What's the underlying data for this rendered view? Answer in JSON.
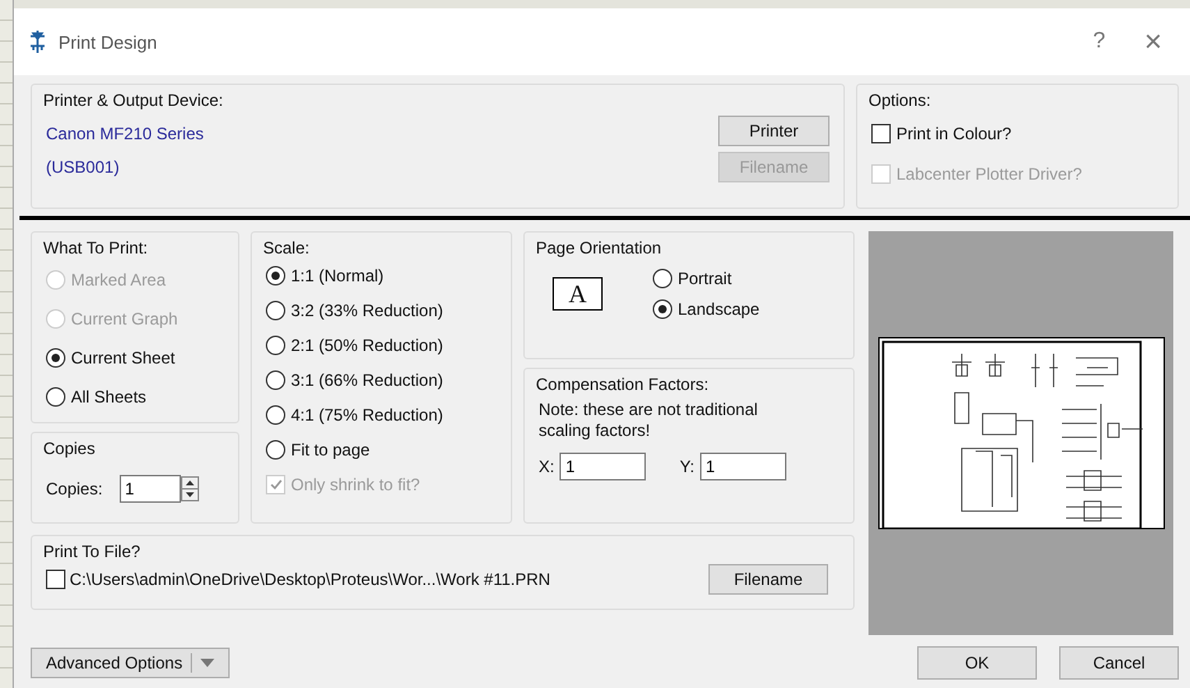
{
  "window": {
    "title": "Print Design",
    "help": "?",
    "close": "×"
  },
  "printer": {
    "title": "Printer & Output Device:",
    "name": "Canon MF210 Series",
    "port": "(USB001)",
    "buttons": [
      {
        "label": "Printer",
        "disabled": false
      },
      {
        "label": "Filename",
        "disabled": true
      }
    ]
  },
  "options": {
    "title": "Options:",
    "items": [
      {
        "label": "Print in Colour?",
        "checked": false,
        "disabled": false
      },
      {
        "label": "Labcenter Plotter Driver?",
        "checked": false,
        "disabled": true
      }
    ]
  },
  "what_to_print": {
    "title": "What To Print:",
    "items": [
      {
        "label": "Marked Area",
        "selected": false,
        "disabled": true
      },
      {
        "label": "Current Graph",
        "selected": false,
        "disabled": true
      },
      {
        "label": "Current Sheet",
        "selected": true,
        "disabled": false
      },
      {
        "label": "All Sheets",
        "selected": false,
        "disabled": false
      }
    ]
  },
  "copies": {
    "title": "Copies",
    "label": "Copies:",
    "value": "1"
  },
  "scale": {
    "title": "Scale:",
    "items": [
      {
        "label": "1:1 (Normal)",
        "selected": true
      },
      {
        "label": "3:2 (33% Reduction)",
        "selected": false
      },
      {
        "label": "2:1 (50% Reduction)",
        "selected": false
      },
      {
        "label": "3:1 (66% Reduction)",
        "selected": false
      },
      {
        "label": "4:1 (75% Reduction)",
        "selected": false
      },
      {
        "label": "Fit to page",
        "selected": false
      }
    ],
    "shrink": {
      "label": "Only shrink to fit?",
      "checked": true,
      "disabled": true
    }
  },
  "orientation": {
    "title": "Page Orientation",
    "icon_letter": "A",
    "items": [
      {
        "label": "Portrait",
        "selected": false
      },
      {
        "label": "Landscape",
        "selected": true
      }
    ]
  },
  "compensation": {
    "title": "Compensation Factors:",
    "note": "Note: these are not traditional scaling factors!",
    "x": {
      "label": "X:",
      "value": "1"
    },
    "y": {
      "label": "Y:",
      "value": "1"
    }
  },
  "print_to_file": {
    "title": "Print To File?",
    "checked": false,
    "path": "C:\\Users\\admin\\OneDrive\\Desktop\\Proteus\\Wor...\\Work #11.PRN",
    "button": "Filename"
  },
  "footer": {
    "advanced": "Advanced Options",
    "ok": "OK",
    "cancel": "Cancel"
  }
}
